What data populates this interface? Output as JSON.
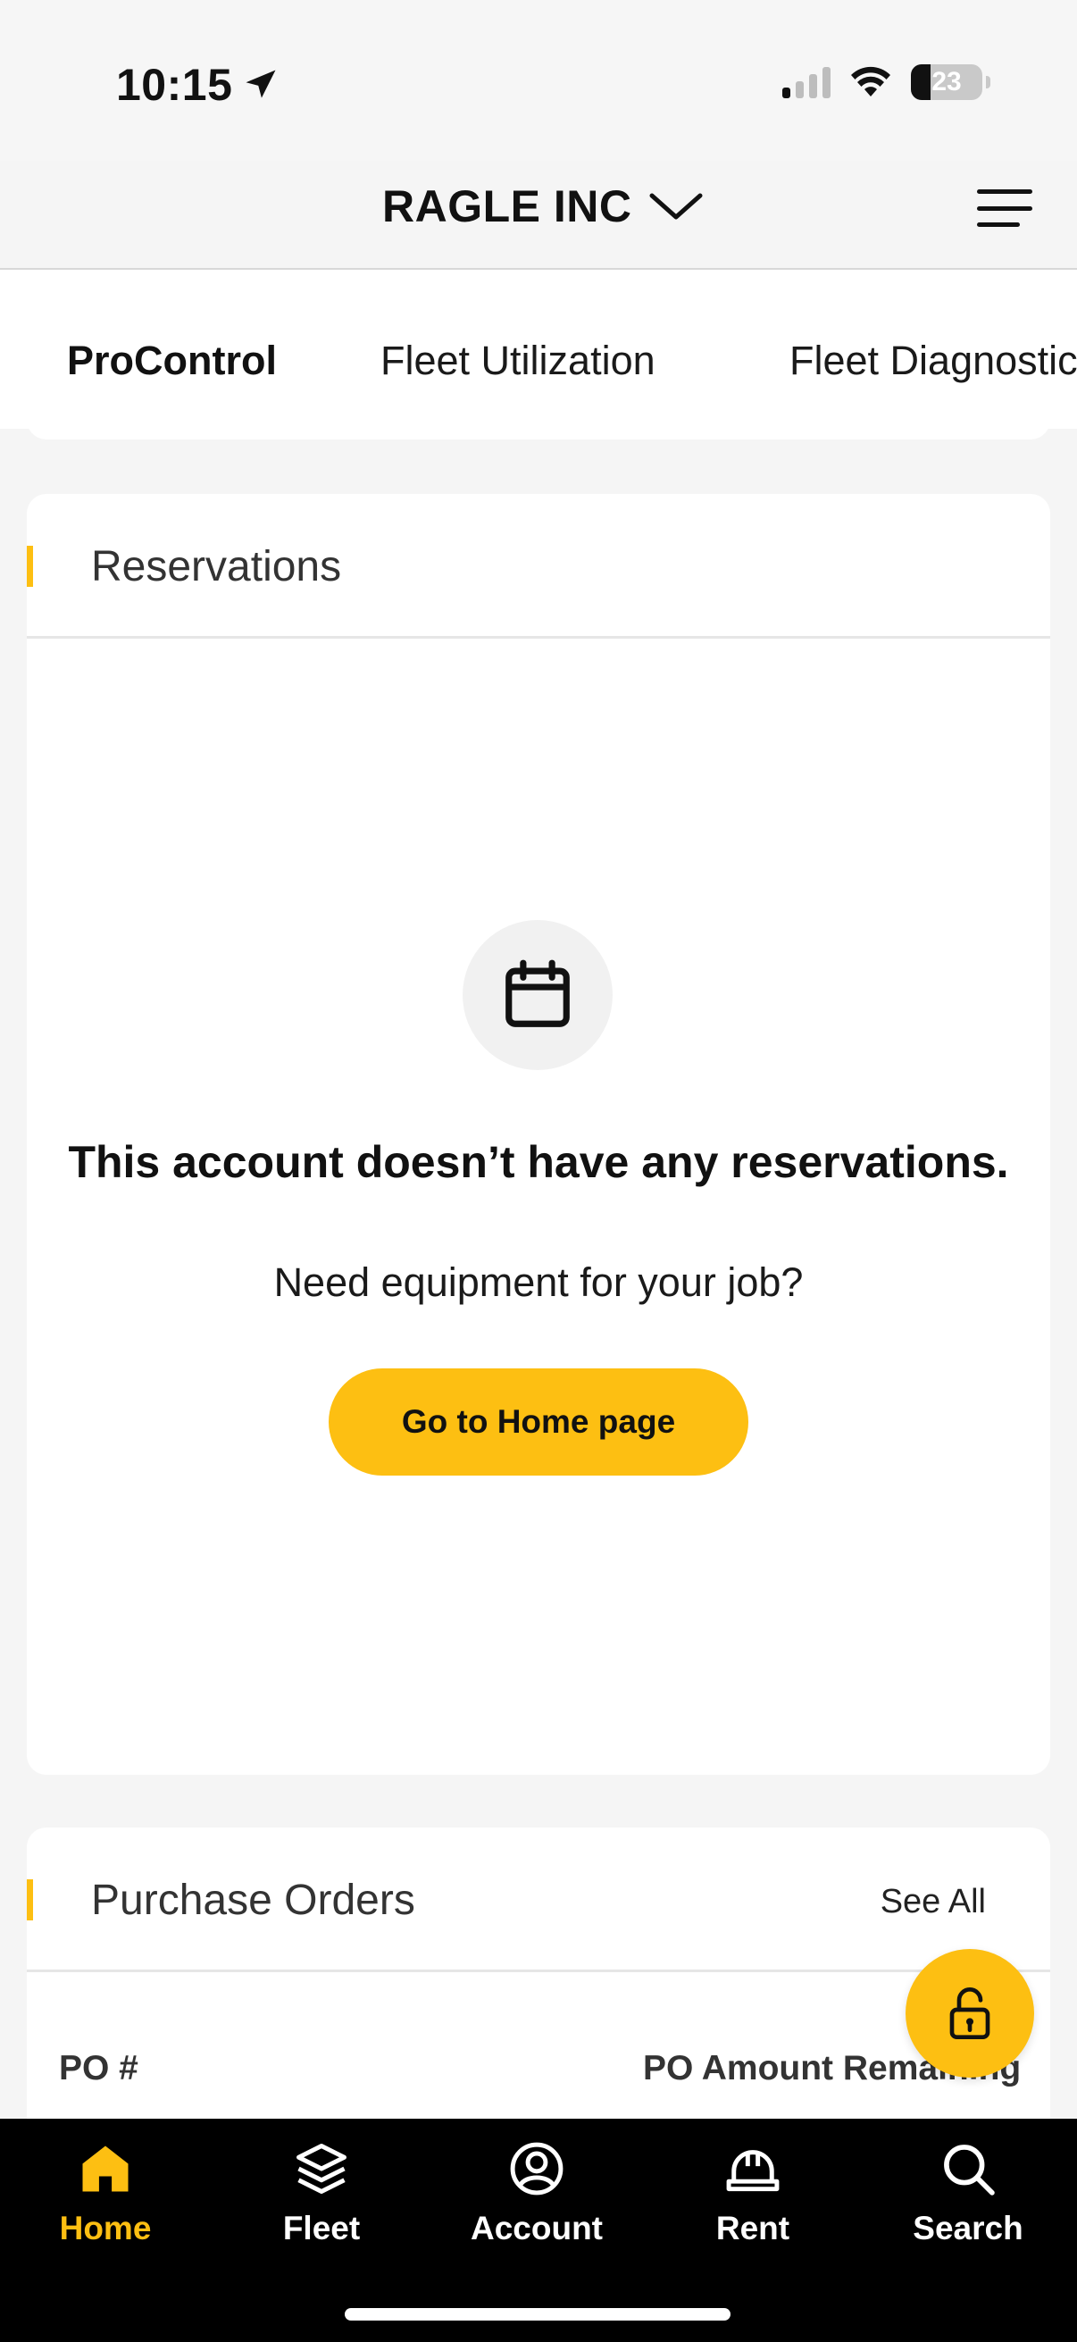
{
  "status_bar": {
    "time": "10:15",
    "battery": "23"
  },
  "header": {
    "account_name": "RAGLE INC"
  },
  "tabs": [
    {
      "label": "ProControl",
      "active": true
    },
    {
      "label": "Fleet Utilization",
      "active": false
    },
    {
      "label": "Fleet Diagnostics",
      "active": false
    }
  ],
  "reservations": {
    "title": "Reservations",
    "empty_title": "This account doesn’t have any reservations.",
    "empty_subtitle": "Need equipment for your job?",
    "cta_label": "Go to Home page"
  },
  "purchase_orders": {
    "title": "Purchase Orders",
    "see_all_label": "See All",
    "columns": [
      "PO #",
      "PO Amount Remaining"
    ]
  },
  "bottom_nav": [
    {
      "label": "Home",
      "icon": "home-icon",
      "active": true
    },
    {
      "label": "Fleet",
      "icon": "layers-icon",
      "active": false
    },
    {
      "label": "Account",
      "icon": "account-icon",
      "active": false
    },
    {
      "label": "Rent",
      "icon": "hardhat-icon",
      "active": false
    },
    {
      "label": "Search",
      "icon": "search-icon",
      "active": false
    }
  ],
  "colors": {
    "accent": "#fdbf12",
    "nav_background": "#000000",
    "page_background": "#f5f5f5"
  }
}
